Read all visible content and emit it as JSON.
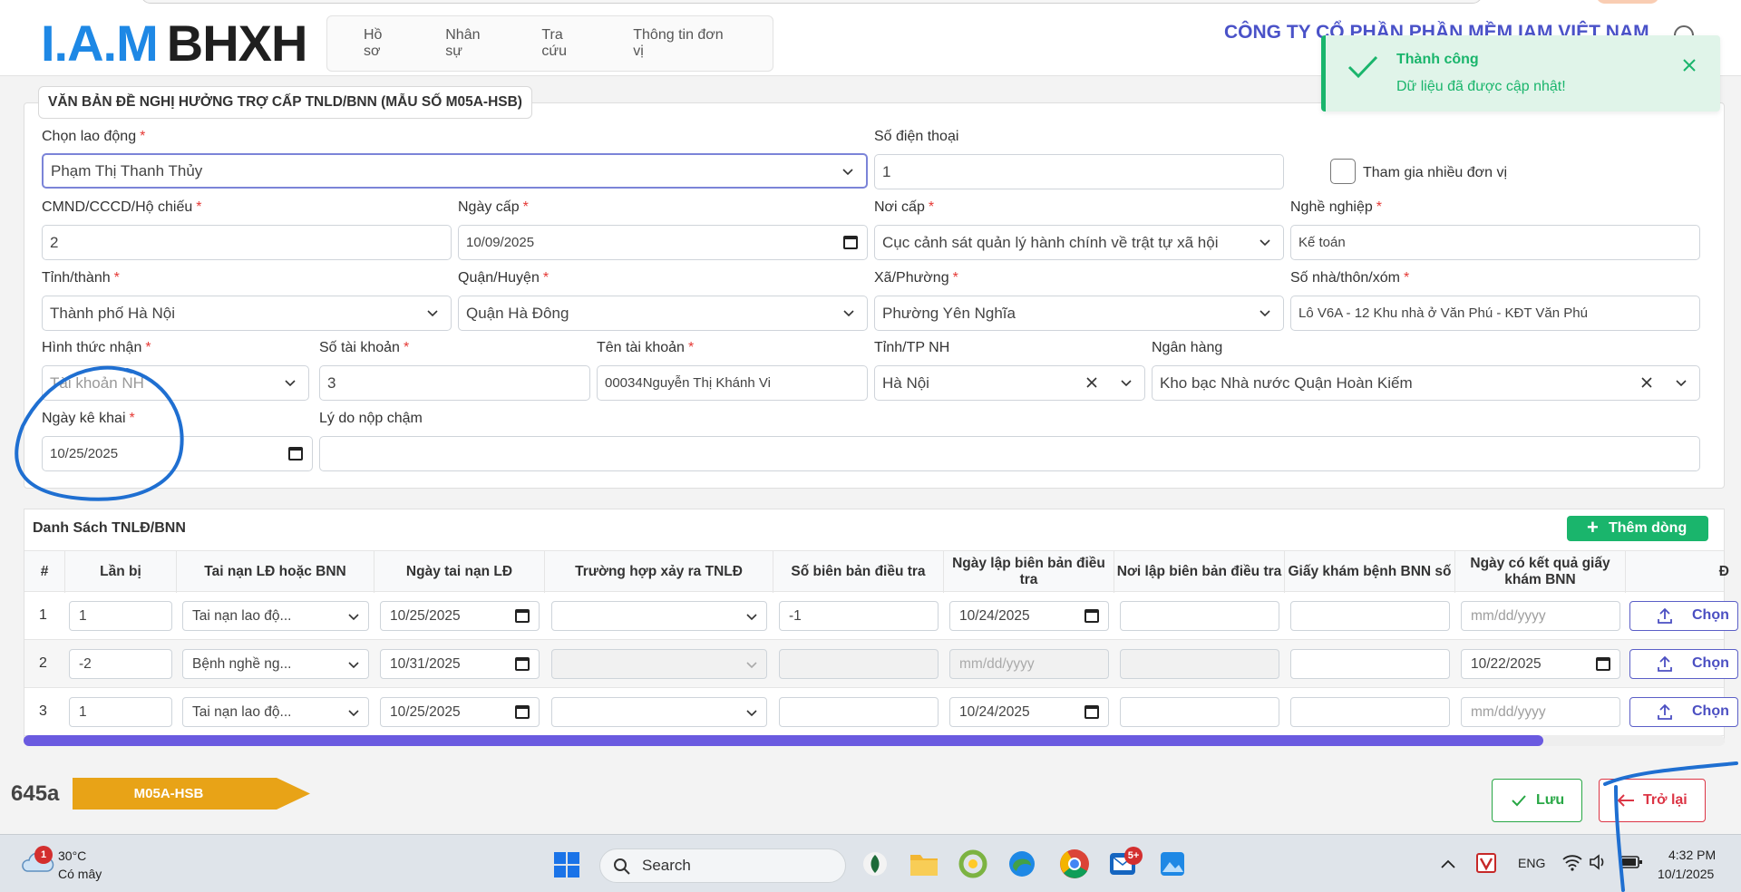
{
  "header": {
    "logo_iam": "I.A.M",
    "logo_bhxh": "BHXH",
    "menu": [
      "Hồ sơ",
      "Nhân sự",
      "Tra cứu",
      "Thông tin đơn vị"
    ],
    "company": "CÔNG TY CỔ PHẦN PHẦN MỀM IAM VIỆT NAM"
  },
  "toast": {
    "title": "Thành công",
    "message": "Dữ liệu đã được cập nhật!"
  },
  "form": {
    "title": "VĂN BẢN ĐỀ NGHỊ HƯỞNG TRỢ CẤP TNLD/BNN (MẪU SỐ M05A-HSB)",
    "labels": {
      "employee": "Chọn lao động",
      "phone": "Số điện thoại",
      "multi_unit": "Tham gia nhiều đơn vị",
      "id": "CMND/CCCD/Hộ chiếu",
      "issue_date": "Ngày cấp",
      "issue_place": "Nơi cấp",
      "job": "Nghề nghiệp",
      "province": "Tỉnh/thành",
      "district": "Quận/Huyện",
      "ward": "Xã/Phường",
      "address": "Số nhà/thôn/xóm",
      "receive_method": "Hình thức nhận",
      "account_no": "Số tài khoản",
      "account_name": "Tên tài khoản",
      "bank_province": "Tỉnh/TP NH",
      "bank": "Ngân hàng",
      "declare_date": "Ngày kê khai",
      "late_reason": "Lý do nộp chậm"
    },
    "values": {
      "employee": "Phạm Thị Thanh Thủy",
      "phone": "1",
      "id": "2",
      "issue_date": "10/09/2025",
      "issue_place": "Cục cảnh sát quản lý hành chính về trật tự xã hội",
      "job": "Kế toán",
      "province": "Thành phố Hà Nội",
      "district": "Quận Hà Đông",
      "ward": "Phường Yên Nghĩa",
      "address": "Lô V6A - 12 Khu nhà ở Văn Phú - KĐT Văn Phú",
      "receive_method": "Tài khoản NH",
      "account_no": "3",
      "account_name": "00034Nguyễn Thị Khánh Vi",
      "bank_province": "Hà Nội",
      "bank": "Kho bạc Nhà nước Quận Hoàn Kiếm",
      "declare_date": "10/25/2025",
      "late_reason": ""
    }
  },
  "table": {
    "title": "Danh Sách TNLĐ/BNN",
    "add_label": "Thêm dòng",
    "headers": [
      "#",
      "Lần bị",
      "Tai nạn LĐ hoặc BNN",
      "Ngày tai nạn LĐ",
      "Trường hợp xảy ra TNLĐ",
      "Số biên bản điều tra",
      "Ngày lập biên bản điều tra",
      "Nơi lập biên bản điều tra",
      "Giấy khám bệnh BNN số",
      "Ngày có kết quả giấy khám BNN",
      "Đ"
    ],
    "date_placeholder": "mm/dd/yyyy",
    "upload_label": "Chọn",
    "rows": [
      {
        "idx": "1",
        "times": "1",
        "type": "Tai nạn lao độ...",
        "date": "10/25/2025",
        "case": "",
        "report_no": "-1",
        "report_date": "10/24/2025",
        "report_place": "",
        "cert_no": "",
        "result_date": ""
      },
      {
        "idx": "2",
        "times": "-2",
        "type": "Bệnh nghề ng...",
        "date": "10/31/2025",
        "case": "",
        "report_no": "",
        "report_date": "",
        "report_place": "",
        "cert_no": "",
        "result_date": "10/22/2025"
      },
      {
        "idx": "3",
        "times": "1",
        "type": "Tai nạn lao độ...",
        "date": "10/25/2025",
        "case": "",
        "report_no": "",
        "report_date": "10/24/2025",
        "report_place": "",
        "cert_no": "",
        "result_date": ""
      }
    ]
  },
  "footer": {
    "code": "645a",
    "form_code": "M05A-HSB",
    "save": "Lưu",
    "back": "Trở lại"
  },
  "taskbar": {
    "temp": "30°C",
    "condition": "Có mây",
    "weather_badge": "1",
    "search": "Search",
    "lang": "ENG",
    "time": "4:32 PM",
    "date": "10/1/2025",
    "mail_badge": "5+"
  },
  "colors": {
    "brand": "#1e88e5",
    "accent": "#4a52c8",
    "success": "#1ab56c",
    "danger": "#dc3545",
    "ribbon": "#e8a317",
    "scroll": "#6a5ae0"
  }
}
